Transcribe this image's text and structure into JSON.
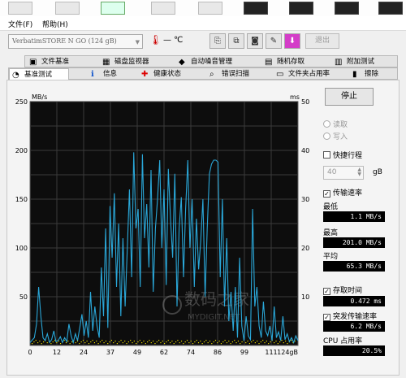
{
  "menu": {
    "file": "文件(F)",
    "help": "帮助(H)"
  },
  "toolbar": {
    "drive": "VerbatimSTORE N GO (124 gB)",
    "temperature": "— ℃",
    "exit_label": "退出"
  },
  "tabs_top": [
    {
      "label": "文件基准"
    },
    {
      "label": "磁盘监视器"
    },
    {
      "label": "自动噪音管理"
    },
    {
      "label": "随机存取"
    },
    {
      "label": "附加测试"
    }
  ],
  "tabs_bottom": [
    {
      "label": "基准测试"
    },
    {
      "label": "信息"
    },
    {
      "label": "健康状态"
    },
    {
      "label": "错误扫描"
    },
    {
      "label": "文件夹占用率"
    },
    {
      "label": "擦除"
    }
  ],
  "side": {
    "start_label": "停止",
    "read_label": "读取",
    "write_label": "写入",
    "quick_label": "快捷行程",
    "quick_value": "40",
    "quick_unit": "gB",
    "transfer_label": "传输速率",
    "min_label": "最低",
    "min_value": "1.1 MB/s",
    "max_label": "最高",
    "max_value": "201.0 MB/s",
    "avg_label": "平均",
    "avg_value": "65.3 MB/s",
    "access_label": "存取时间",
    "access_value": "0.472 ms",
    "burst_label": "突发传输速率",
    "burst_value": "6.2 MB/s",
    "cpu_label": "CPU 占用率",
    "cpu_value": "20.5%"
  },
  "chart_data": {
    "type": "line",
    "left_unit": "MB/s",
    "right_unit": "ms",
    "left_ticks": [
      250,
      200,
      150,
      100,
      50
    ],
    "right_ticks": [
      50,
      40,
      30,
      20,
      10
    ],
    "x_ticks": [
      "0",
      "12",
      "24",
      "37",
      "49",
      "62",
      "74",
      "86",
      "99",
      "111",
      "124gB"
    ],
    "ylim": [
      0,
      250
    ],
    "y2lim": [
      0,
      50
    ],
    "xlim": [
      0,
      124
    ],
    "watermark": "数码之家",
    "watermark_sub": "MYDIGIT.NET",
    "series": [
      {
        "color": "#2aa7d8",
        "x": [
          0,
          2,
          3,
          4,
          5,
          6,
          7,
          8,
          9,
          10,
          11,
          12,
          13,
          14,
          15,
          16,
          17,
          18,
          19,
          20,
          21,
          22,
          23,
          24,
          25,
          26,
          27,
          28,
          29,
          30,
          31,
          32,
          33,
          34,
          35,
          36,
          37,
          38,
          39,
          40,
          41,
          42,
          43,
          44,
          45,
          46,
          47,
          48,
          49,
          50,
          51,
          52,
          53,
          54,
          55,
          56,
          57,
          58,
          59,
          60,
          61,
          62,
          63,
          64,
          65,
          66,
          67,
          68,
          69,
          70,
          71,
          72,
          73,
          74,
          75,
          76,
          77,
          78,
          79,
          80,
          81,
          82,
          83,
          84,
          85,
          86,
          87,
          88,
          89,
          90,
          91,
          92,
          93,
          94,
          95,
          96,
          97,
          98,
          99,
          100,
          101,
          102,
          103,
          104,
          105,
          106,
          107,
          108,
          109,
          110,
          111,
          112,
          113,
          114,
          115,
          116,
          117,
          118,
          119,
          120,
          121,
          122,
          123,
          124
        ],
        "y": [
          3,
          8,
          22,
          60,
          30,
          8,
          5,
          12,
          3,
          6,
          15,
          4,
          5,
          9,
          3,
          8,
          4,
          22,
          10,
          3,
          12,
          5,
          18,
          32,
          10,
          25,
          8,
          55,
          15,
          40,
          20,
          8,
          80,
          30,
          120,
          18,
          143,
          90,
          156,
          60,
          125,
          30,
          110,
          40,
          100,
          160,
          70,
          198,
          120,
          140,
          60,
          196,
          110,
          145,
          80,
          180,
          55,
          120,
          150,
          190,
          100,
          160,
          62,
          181,
          130,
          90,
          176,
          40,
          120,
          152,
          70,
          140,
          190,
          100,
          150,
          60,
          130,
          78,
          107,
          150,
          50,
          120,
          176,
          186,
          190,
          190,
          188,
          70,
          150,
          40,
          110,
          25,
          55,
          15,
          60,
          8,
          90,
          20,
          5,
          30,
          10,
          6,
          140,
          40,
          60,
          20,
          8,
          45,
          15,
          10,
          20,
          5,
          40,
          8,
          14,
          5,
          30,
          6,
          12,
          4,
          8,
          3,
          10,
          5
        ]
      }
    ]
  }
}
